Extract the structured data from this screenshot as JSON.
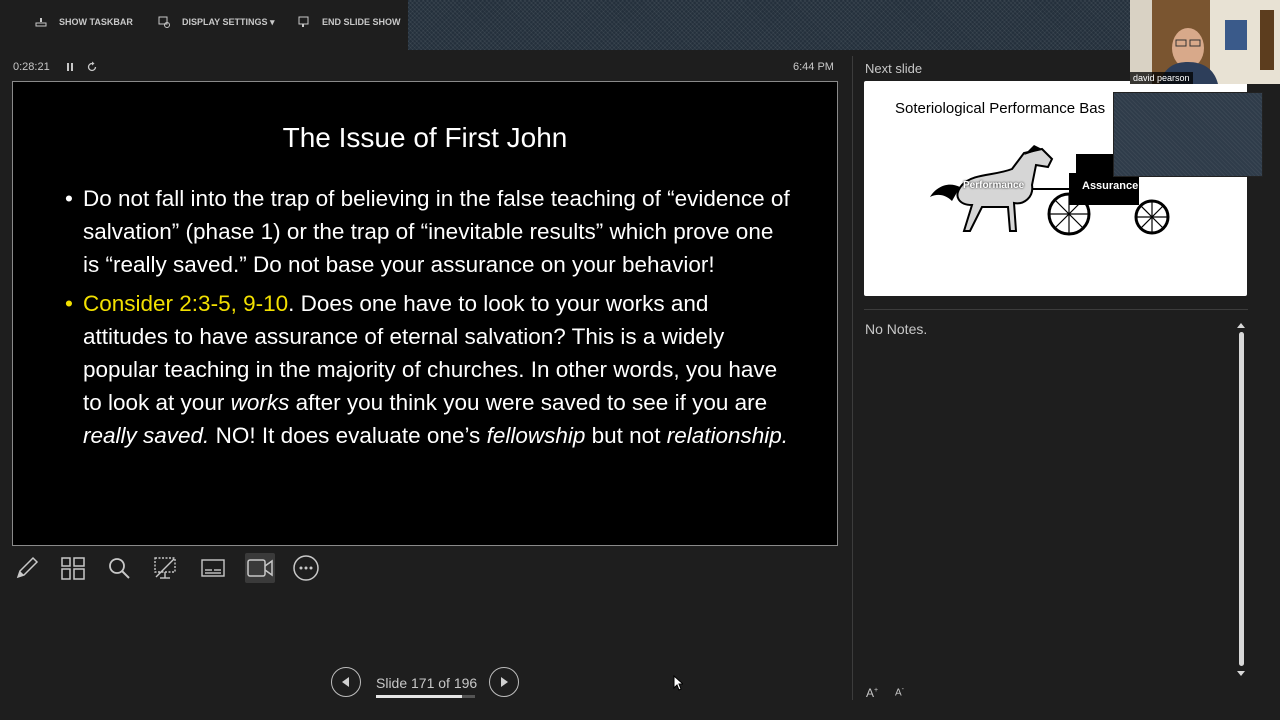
{
  "toolbar": {
    "show_taskbar": "SHOW TASKBAR",
    "display_settings": "DISPLAY SETTINGS ▾",
    "end_slide_show": "END SLIDE SHOW"
  },
  "timer": {
    "elapsed": "0:28:21",
    "pause_icon": "pause-icon",
    "restart_icon": "restart-icon"
  },
  "clock": "6:44 PM",
  "current_slide": {
    "title": "The Issue of First John",
    "bullet1": "Do not fall into the trap of believing in the false teaching of “evidence of salvation” (phase 1) or the trap of “inevitable results” which prove one is “really saved.” Do not base your assurance on your behavior!",
    "bullet2_highlight": "Consider 2:3-5, 9-10",
    "bullet2_a": ". Does one have to look to your works and attitudes to have assurance of eternal salvation? This is a widely popular teaching in the majority of churches. In other words, you have to look at your ",
    "bullet2_works": "works",
    "bullet2_b": " after you think you were saved to see if you are ",
    "bullet2_really_saved": "really saved.",
    "bullet2_c": " NO! It does evaluate one’s ",
    "bullet2_fellowship": "fellowship",
    "bullet2_d": " but not ",
    "bullet2_relationship": "relationship.",
    "highlight_color": "#f2e000"
  },
  "tools": [
    "pen-icon",
    "see-all-slides-icon",
    "zoom-icon",
    "black-screen-icon",
    "subtitles-icon",
    "camera-icon",
    "more-options-icon"
  ],
  "navigation": {
    "counter": "Slide 171 of 196",
    "current": 171,
    "total": 196,
    "progress": 0.872
  },
  "next_slide": {
    "label": "Next slide",
    "title": "Soteriological Performance Bas",
    "horse_label": "Performance",
    "cart_label": "Assurance"
  },
  "notes": {
    "text": "No Notes.",
    "increase_font": "A",
    "decrease_font": "A"
  },
  "video": {
    "participant_name": "david pearson"
  }
}
